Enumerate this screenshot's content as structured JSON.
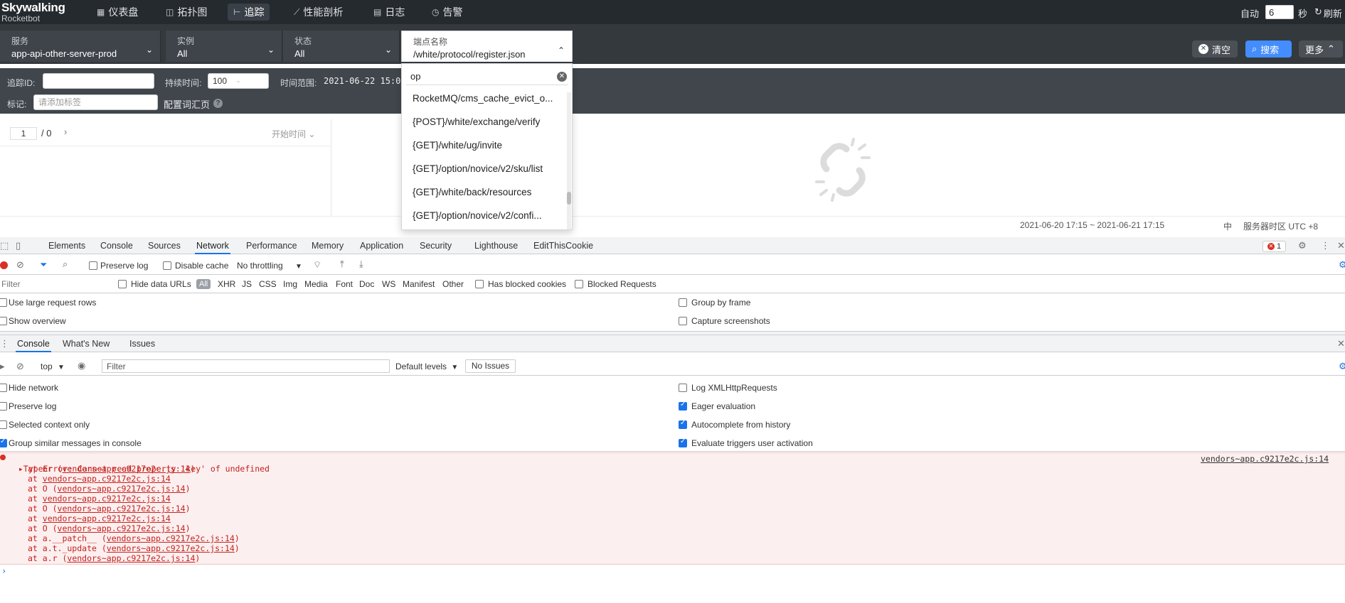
{
  "brand": {
    "line1": "Skywalking",
    "line2": "Rocketbot"
  },
  "nav": [
    {
      "label": "仪表盘",
      "icon": "dashboard-icon"
    },
    {
      "label": "拓扑图",
      "icon": "topology-icon"
    },
    {
      "label": "追踪",
      "icon": "trace-icon",
      "active": true
    },
    {
      "label": "性能剖析",
      "icon": "profile-icon"
    },
    {
      "label": "日志",
      "icon": "log-icon"
    },
    {
      "label": "告警",
      "icon": "alarm-icon"
    }
  ],
  "autorefresh": {
    "label": "自动",
    "value": "6",
    "unit": "秒",
    "refresh": "刷新"
  },
  "filters": {
    "service": {
      "label": "服务",
      "value": "app-api-other-server-prod"
    },
    "instance": {
      "label": "实例",
      "value": "All"
    },
    "status": {
      "label": "状态",
      "value": "All"
    },
    "endpoint": {
      "label": "端点名称",
      "value": "/white/protocol/register.json"
    }
  },
  "buttons": {
    "clear": "清空",
    "search": "搜索",
    "more": "更多"
  },
  "sub": {
    "trace_id_label": "追踪ID:",
    "duration_label": "持续时间:",
    "duration_value": "100",
    "duration_sep": "-",
    "range_label": "时间范围:",
    "range_value": "2021-06-22 15:05",
    "tag_label": "标记:",
    "tag_placeholder": "请添加标签",
    "vocab_label": "配置词汇页"
  },
  "dropdown": {
    "query": "op",
    "items": [
      "RocketMQ/cms_cache_evict_o...",
      "{POST}/white/exchange/verify",
      "{GET}/white/ug/invite",
      "{GET}/option/novice/v2/sku/list",
      "{GET}/white/back/resources",
      "{GET}/option/novice/v2/confi..."
    ]
  },
  "tracelist": {
    "page": "1",
    "total": "/ 0",
    "sort": "开始时间"
  },
  "footer": {
    "range": "2021-06-20 17:15 ~ 2021-06-21 17:15",
    "lang": "中",
    "tz": "服务器时区 UTC +8"
  },
  "devtools": {
    "tabs": [
      "Elements",
      "Console",
      "Sources",
      "Network",
      "Performance",
      "Memory",
      "Application",
      "Security",
      "Lighthouse",
      "EditThisCookie"
    ],
    "active_tab": "Network",
    "error_count": "1",
    "net": {
      "preserve_log": "Preserve log",
      "disable_cache": "Disable cache",
      "throttling": "No throttling"
    },
    "filter_placeholder": "Filter",
    "hide_data_urls": "Hide data URLs",
    "types": [
      "All",
      "XHR",
      "JS",
      "CSS",
      "Img",
      "Media",
      "Font",
      "Doc",
      "WS",
      "Manifest",
      "Other"
    ],
    "has_blocked_cookies": "Has blocked cookies",
    "blocked_requests": "Blocked Requests",
    "settings": {
      "large_rows": "Use large request rows",
      "overview": "Show overview",
      "group_frame": "Group by frame",
      "capture": "Capture screenshots"
    },
    "drawer_tabs": [
      "Console",
      "What's New",
      "Issues"
    ],
    "console": {
      "context": "top",
      "filter_placeholder": "Filter",
      "levels": "Default levels",
      "issues": "No Issues",
      "hide_network": "Hide network",
      "preserve_log": "Preserve log",
      "selected_context": "Selected context only",
      "group_similar": "Group similar messages in console",
      "log_xhr": "Log XMLHttpRequests",
      "eager_eval": "Eager evaluation",
      "autocomplete": "Autocomplete from history",
      "eval_triggers": "Evaluate triggers user activation"
    },
    "error": {
      "message": "TypeError: Cannot read property 'key' of undefined",
      "source": "vendors~app.c9217e2c.js:14",
      "stack": [
        {
          "fn": "at nr (",
          "loc": "vendors~app.c9217e2c.js:14",
          "end": ")"
        },
        {
          "fn": "at ",
          "loc": "vendors~app.c9217e2c.js:14",
          "end": ""
        },
        {
          "fn": "at O (",
          "loc": "vendors~app.c9217e2c.js:14",
          "end": ")"
        },
        {
          "fn": "at ",
          "loc": "vendors~app.c9217e2c.js:14",
          "end": ""
        },
        {
          "fn": "at O (",
          "loc": "vendors~app.c9217e2c.js:14",
          "end": ")"
        },
        {
          "fn": "at ",
          "loc": "vendors~app.c9217e2c.js:14",
          "end": ""
        },
        {
          "fn": "at O (",
          "loc": "vendors~app.c9217e2c.js:14",
          "end": ")"
        },
        {
          "fn": "at a.__patch__ (",
          "loc": "vendors~app.c9217e2c.js:14",
          "end": ")"
        },
        {
          "fn": "at a.t._update (",
          "loc": "vendors~app.c9217e2c.js:14",
          "end": ")"
        },
        {
          "fn": "at a.r (",
          "loc": "vendors~app.c9217e2c.js:14",
          "end": ")"
        }
      ]
    }
  }
}
